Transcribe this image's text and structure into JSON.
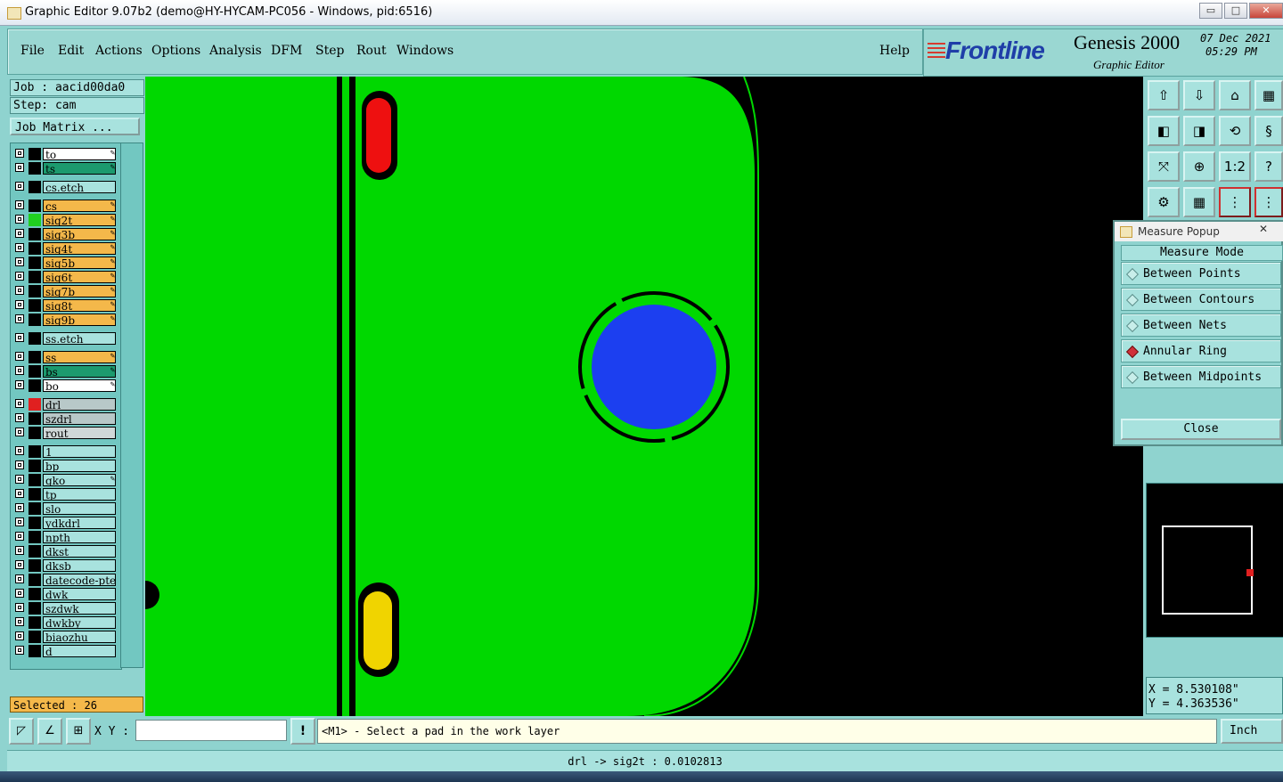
{
  "window": {
    "title": "Graphic Editor 9.07b2 (demo@HY-HYCAM-PC056 - Windows, pid:6516)",
    "min_label": "▭",
    "max_label": "□",
    "close_label": "✕"
  },
  "menu": {
    "items": [
      "File",
      "Edit",
      "Actions",
      "Options",
      "Analysis",
      "DFM",
      "Step",
      "Rout",
      "Windows"
    ],
    "help": "Help"
  },
  "logo": {
    "brand": "Frontline",
    "product": "Genesis 2000",
    "subtitle": "Graphic Editor",
    "date": "07  Dec  2021",
    "time": "05:29  PM"
  },
  "job": {
    "job_label": "Job : aacid00da0",
    "step_label": "Step: cam",
    "matrix_button": "Job Matrix ..."
  },
  "layers": [
    {
      "name": "to",
      "color": "#ffffff",
      "swatch": "#000000",
      "edit": true
    },
    {
      "name": "ts",
      "color": "#1c9a6e",
      "swatch": "#000000",
      "edit": true
    },
    {
      "name": "cs.etch",
      "color": "#a8e2de",
      "swatch": "#000000",
      "edit": false
    },
    {
      "name": "cs",
      "color": "#f4b84a",
      "swatch": "#000000",
      "edit": true
    },
    {
      "name": "sig2t",
      "color": "#f4b84a",
      "swatch": "#20d020",
      "edit": true
    },
    {
      "name": "sig3b",
      "color": "#f4b84a",
      "swatch": "#000000",
      "edit": true
    },
    {
      "name": "sig4t",
      "color": "#f4b84a",
      "swatch": "#000000",
      "edit": true
    },
    {
      "name": "sig5b",
      "color": "#f4b84a",
      "swatch": "#000000",
      "edit": true
    },
    {
      "name": "sig6t",
      "color": "#f4b84a",
      "swatch": "#000000",
      "edit": true
    },
    {
      "name": "sig7b",
      "color": "#f4b84a",
      "swatch": "#000000",
      "edit": true
    },
    {
      "name": "sig8t",
      "color": "#f4b84a",
      "swatch": "#000000",
      "edit": true
    },
    {
      "name": "sig9b",
      "color": "#f4b84a",
      "swatch": "#000000",
      "edit": true
    },
    {
      "name": "ss.etch",
      "color": "#a8e2de",
      "swatch": "#000000",
      "edit": false
    },
    {
      "name": "ss",
      "color": "#f4b84a",
      "swatch": "#000000",
      "edit": true
    },
    {
      "name": "bs",
      "color": "#1c9a6e",
      "swatch": "#000000",
      "edit": true
    },
    {
      "name": "bo",
      "color": "#ffffff",
      "swatch": "#000000",
      "edit": true
    },
    {
      "name": "drl",
      "color": "#b8c8c8",
      "swatch": "#e02020",
      "edit": false
    },
    {
      "name": "szdrl",
      "color": "#b8c8c8",
      "swatch": "#000000",
      "edit": false
    },
    {
      "name": "rout",
      "color": "#d0d8d8",
      "swatch": "#000000",
      "edit": false
    },
    {
      "name": "1",
      "color": "#a8e2de",
      "swatch": "#000000",
      "edit": false
    },
    {
      "name": "bp",
      "color": "#a8e2de",
      "swatch": "#000000",
      "edit": false
    },
    {
      "name": "gko",
      "color": "#a8e2de",
      "swatch": "#000000",
      "edit": true
    },
    {
      "name": "tp",
      "color": "#a8e2de",
      "swatch": "#000000",
      "edit": false
    },
    {
      "name": "slo",
      "color": "#a8e2de",
      "swatch": "#000000",
      "edit": false
    },
    {
      "name": "ydkdrl",
      "color": "#a8e2de",
      "swatch": "#000000",
      "edit": false
    },
    {
      "name": "npth",
      "color": "#a8e2de",
      "swatch": "#000000",
      "edit": false
    },
    {
      "name": "dkst",
      "color": "#a8e2de",
      "swatch": "#000000",
      "edit": false
    },
    {
      "name": "dksb",
      "color": "#a8e2de",
      "swatch": "#000000",
      "edit": false
    },
    {
      "name": "datecode-pte",
      "color": "#a8e2de",
      "swatch": "#000000",
      "edit": false
    },
    {
      "name": "dwk",
      "color": "#a8e2de",
      "swatch": "#000000",
      "edit": false
    },
    {
      "name": "szdwk",
      "color": "#a8e2de",
      "swatch": "#000000",
      "edit": false
    },
    {
      "name": "dwkby",
      "color": "#a8e2de",
      "swatch": "#000000",
      "edit": false
    },
    {
      "name": "biaozhu",
      "color": "#a8e2de",
      "swatch": "#000000",
      "edit": false
    },
    {
      "name": "d",
      "color": "#a8e2de",
      "swatch": "#000000",
      "edit": false
    }
  ],
  "selected": "Selected : 26",
  "toolbar": {
    "icons": [
      "zoom-home-icon",
      "zoom-back-icon",
      "home-icon",
      "window-icon",
      "pan-left-icon",
      "pan-right-icon",
      "redo-icon",
      "snap-icon",
      "fit-icon",
      "center-icon",
      "one-to-one-icon",
      "help-icon",
      "measure-icon",
      "grid-icon",
      "net-icon",
      "net2-icon"
    ],
    "one_to_one_label": "1:2",
    "help_label": "?"
  },
  "measure_popup": {
    "title": "Measure Popup",
    "header": "Measure Mode",
    "modes": [
      "Between Points",
      "Between Contours",
      "Between Nets",
      "Annular Ring",
      "Between Midpoints"
    ],
    "active": "Annular Ring",
    "close": "Close"
  },
  "coords": {
    "x": "X = 8.530108\"",
    "y": "Y = 4.363536\""
  },
  "command": {
    "xy_label": "X Y :",
    "input_value": "",
    "prompt": "<M1> - Select a pad in the work layer",
    "units": "Inch"
  },
  "status": "drl -> sig2t : 0.0102813",
  "colors": {
    "board": "#00d800",
    "pad_blue": "#1c3ff0",
    "pad_red": "#ee1010",
    "pad_yellow": "#f0d400"
  }
}
